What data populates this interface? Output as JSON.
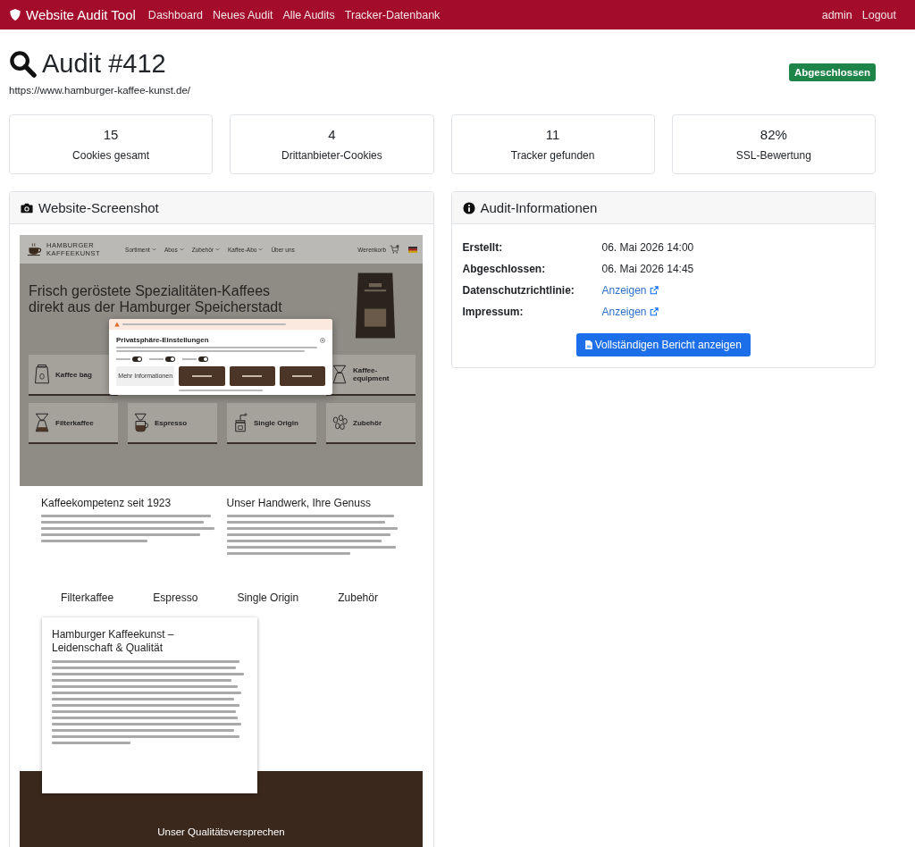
{
  "navbar": {
    "brand": "Website Audit Tool",
    "links": [
      "Dashboard",
      "Neues Audit",
      "Alle Audits",
      "Tracker-Datenbank"
    ],
    "user_links": [
      "admin",
      "Logout"
    ]
  },
  "header": {
    "title": "Audit #412",
    "url": "https://www.hamburger-kaffee-kunst.de/",
    "status": "Abgeschlossen"
  },
  "stats": [
    {
      "value": "15",
      "label": "Cookies gesamt"
    },
    {
      "value": "4",
      "label": "Drittanbieter-Cookies"
    },
    {
      "value": "11",
      "label": "Tracker gefunden"
    },
    {
      "value": "82%",
      "label": "SSL-Bewertung"
    }
  ],
  "screenshot_panel": {
    "title": "Website-Screenshot",
    "site": {
      "logo_lines": [
        "HAMBURGER",
        "KAFFEEKUNST"
      ],
      "menu": [
        {
          "label": "Sortiment",
          "dropdown": true
        },
        {
          "label": "Abos",
          "dropdown": true
        },
        {
          "label": "Zubehör",
          "dropdown": true
        },
        {
          "label": "Kaffee-Abo",
          "dropdown": true
        },
        {
          "label": "Über uns",
          "dropdown": false
        }
      ],
      "cart_label": "Werenkorb",
      "hero_title": [
        "Frisch geröstete Spezialitäten-Kaffees",
        "direkt aus der Hamburger Speicherstadt"
      ],
      "top_tiles": [
        {
          "kind": "bag",
          "label": "Kaffee bag"
        },
        {
          "kind": "pourover",
          "label": "Kaffee-equipment"
        }
      ],
      "tiles": [
        {
          "kind": "pourover",
          "label": "Filterkaffee"
        },
        {
          "kind": "cup",
          "label": "Espresso"
        },
        {
          "kind": "grinder",
          "label": "Single Origin"
        },
        {
          "kind": "beans",
          "label": "Zubehör"
        }
      ],
      "consent": {
        "title": "Privatsphäre-Einstellungen",
        "toggles": [
          {
            "on": true
          },
          {
            "on": true
          },
          {
            "on": true
          }
        ],
        "more_button": "Mehr Informationen"
      },
      "sections": [
        {
          "title": "Kaffeekompetenz seit 1923"
        },
        {
          "title": "Unser Handwerk, Ihre Genuss"
        }
      ],
      "categories": [
        "Filterkaffee",
        "Espresso",
        "Single Origin",
        "Zubehör"
      ],
      "card_title": "Hamburger Kaffeekunst – Leidenschaft & Qualität",
      "band_title": "Unser Qualitätsversprechen"
    }
  },
  "info_panel": {
    "title": "Audit-Informationen",
    "rows": [
      {
        "label": "Erstellt:",
        "kind": "text",
        "value": "06. Mai 2026 14:00"
      },
      {
        "label": "Abgeschlossen:",
        "kind": "text",
        "value": "06. Mai 2026 14:45"
      },
      {
        "label": "Datenschutzrichtlinie:",
        "kind": "link",
        "value": "Anzeigen"
      },
      {
        "label": "Impressum:",
        "kind": "link",
        "value": "Anzeigen"
      }
    ],
    "button": "Vollständigen Bericht anzeigen"
  }
}
